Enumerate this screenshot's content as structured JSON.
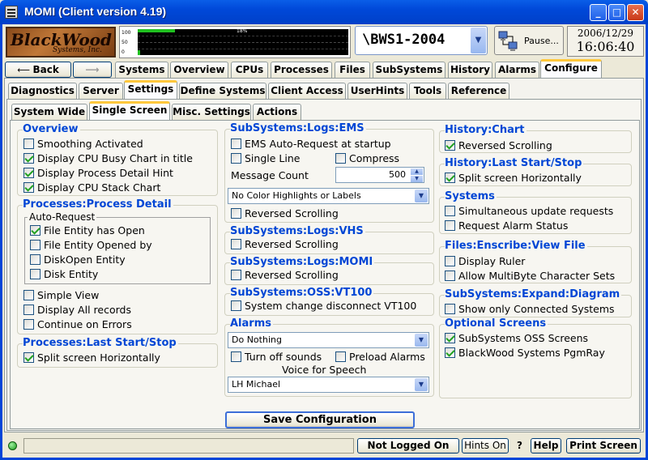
{
  "window": {
    "title": "MOMI (Client version 4.19)",
    "min": "_",
    "max": "□",
    "close": "✕"
  },
  "logo": {
    "line1": "BlackWood",
    "line2": "Systems, Inc."
  },
  "cpu_chart": {
    "ticks": [
      "100",
      "50",
      "0"
    ],
    "label": "18%",
    "busy_level": 0.18
  },
  "system": {
    "name": "\\BWS1-2004"
  },
  "pause_label": "Pause...",
  "datetime": {
    "date": "2006/12/29",
    "time": "16:06:40"
  },
  "nav": {
    "back": "Back",
    "forward": ""
  },
  "main_tabs": [
    "Systems",
    "Overview",
    "CPUs",
    "Processes",
    "Files",
    "SubSystems",
    "History",
    "Alarms",
    "Configure"
  ],
  "config_tabs": [
    "Diagnostics",
    "Server",
    "Settings",
    "Define Systems",
    "Client Access",
    "UserHints",
    "Tools",
    "Reference"
  ],
  "settings_tabs": [
    "System Wide",
    "Single Screen",
    "Misc. Settings",
    "Actions"
  ],
  "overview": {
    "heading": "Overview",
    "items": [
      "Smoothing Activated",
      "Display CPU Busy Chart in title",
      "Display Process Detail Hint",
      "Display CPU Stack Chart"
    ],
    "checked": [
      false,
      true,
      true,
      true
    ]
  },
  "proc_detail": {
    "heading": "Processes:Process Detail",
    "auto_label": "Auto-Request",
    "auto_items": [
      "File Entity has Open",
      "File Entity Opened by",
      "DiskOpen Entity",
      "Disk Entity"
    ],
    "auto_checked": [
      true,
      false,
      false,
      false
    ],
    "items": [
      "Simple View",
      "Display All records",
      "Continue on Errors"
    ]
  },
  "proc_last": {
    "heading": "Processes:Last Start/Stop",
    "item": "Split screen Horizontally"
  },
  "ems": {
    "heading": "SubSystems:Logs:EMS",
    "auto": "EMS Auto-Request at startup",
    "single": "Single Line",
    "compress": "Compress",
    "msg_label": "Message Count",
    "msg_value": "500",
    "color_select": "No Color Highlights or Labels",
    "reversed": "Reversed Scrolling"
  },
  "vhs": {
    "heading": "SubSystems:Logs:VHS",
    "item": "Reversed Scrolling"
  },
  "momi": {
    "heading": "SubSystems:Logs:MOMI",
    "item": "Reversed Scrolling"
  },
  "oss": {
    "heading": "SubSystems:OSS:VT100",
    "item": "System change disconnect VT100"
  },
  "alarms": {
    "heading": "Alarms",
    "select": "Do Nothing",
    "turn_off": "Turn off sounds",
    "preload": "Preload Alarms",
    "voice_label": "Voice for Speech",
    "voice": "LH Michael"
  },
  "hist_chart": {
    "heading": "History:Chart",
    "item": "Reversed Scrolling"
  },
  "hist_last": {
    "heading": "History:Last Start/Stop",
    "item": "Split screen Horizontally"
  },
  "systems": {
    "heading": "Systems",
    "items": [
      "Simultaneous update requests",
      "Request Alarm Status"
    ]
  },
  "files": {
    "heading": "Files:Enscribe:View File",
    "items": [
      "Display Ruler",
      "Allow MultiByte Character Sets"
    ]
  },
  "expand": {
    "heading": "SubSystems:Expand:Diagram",
    "item": "Show only Connected Systems"
  },
  "optional": {
    "heading": "Optional Screens",
    "items": [
      "SubSystems OSS Screens",
      "BlackWood Systems PgmRay"
    ]
  },
  "save_label": "Save Configuration",
  "status": {
    "login": "Not Logged On",
    "hints": "Hints On",
    "q": "?",
    "help": "Help",
    "print": "Print Screen"
  }
}
